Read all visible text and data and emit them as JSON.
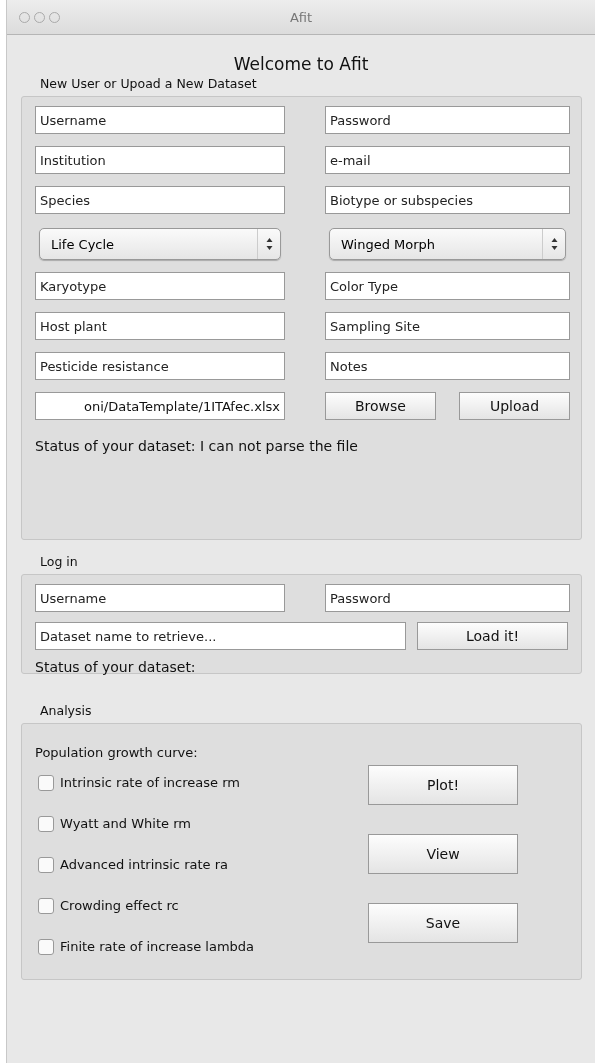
{
  "window": {
    "title": "Afit"
  },
  "heading": "Welcome to Afit",
  "upload": {
    "label": "New User or Upoad a New Dataset",
    "fields": [
      {
        "kind": "text",
        "placeholder": "Username"
      },
      {
        "kind": "text",
        "placeholder": "Password"
      },
      {
        "kind": "text",
        "placeholder": "Institution"
      },
      {
        "kind": "text",
        "placeholder": "e-mail"
      },
      {
        "kind": "text",
        "placeholder": "Species"
      },
      {
        "kind": "text",
        "placeholder": "Biotype or subspecies"
      },
      {
        "kind": "select",
        "value": "Life Cycle"
      },
      {
        "kind": "select",
        "value": "Winged Morph"
      },
      {
        "kind": "text",
        "placeholder": "Karyotype"
      },
      {
        "kind": "text",
        "placeholder": "Color Type"
      },
      {
        "kind": "text",
        "placeholder": "Host plant"
      },
      {
        "kind": "text",
        "placeholder": "Sampling Site"
      },
      {
        "kind": "text",
        "placeholder": "Pesticide resistance"
      },
      {
        "kind": "text",
        "placeholder": "Notes"
      }
    ],
    "file_path": "oni/DataTemplate/1ITAfec.xlsx",
    "buttons": [
      "Browse",
      "Upload"
    ],
    "status": "Status of your dataset: I can not parse the file"
  },
  "login": {
    "label": "Log in",
    "fields": [
      {
        "kind": "text",
        "placeholder": "Username"
      },
      {
        "kind": "text",
        "placeholder": "Password"
      }
    ],
    "dataset": {
      "placeholder": "Dataset name to retrieve..."
    },
    "button": "Load it!",
    "status": "Status of your dataset:"
  },
  "analysis": {
    "label": "Analysis",
    "caption": "Population growth curve:",
    "options": [
      {
        "label": "Intrinsic rate of increase rm",
        "checked": false
      },
      {
        "label": "Wyatt and White rm",
        "checked": false
      },
      {
        "label": "Advanced intrinsic rate ra",
        "checked": false
      },
      {
        "label": "Crowding effect rc",
        "checked": false
      },
      {
        "label": "Finite rate of increase lambda",
        "checked": false
      }
    ],
    "buttons": [
      "Plot!",
      "View",
      "Save"
    ]
  }
}
